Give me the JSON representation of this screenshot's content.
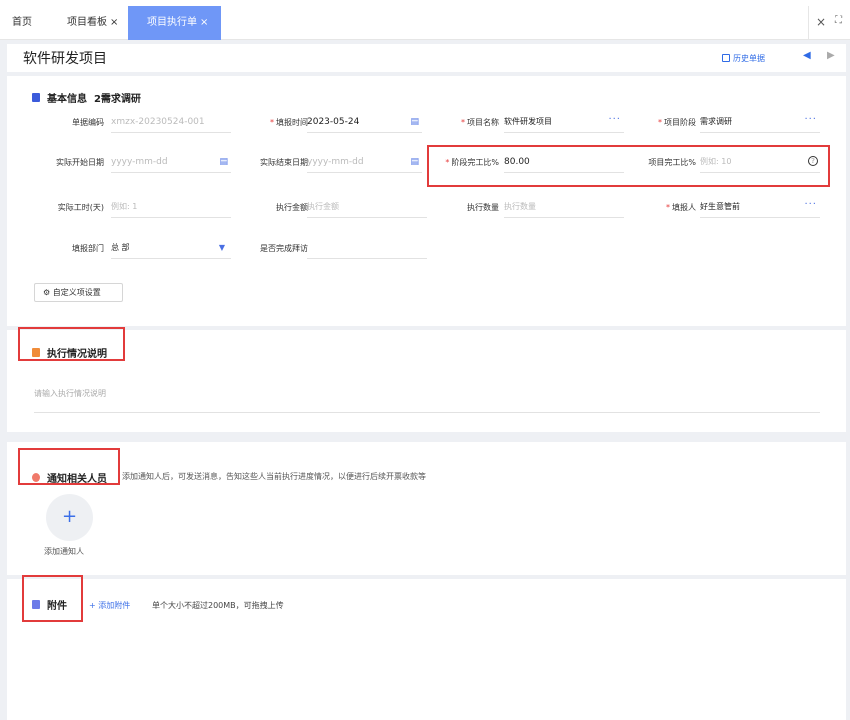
{
  "tabs": {
    "home": "首页",
    "board": "项目看板",
    "active": "项目执行单",
    "close_glyph": "×"
  },
  "header": {
    "title": "软件研发项目",
    "history_label": "历史单据"
  },
  "basic_info": {
    "section_label": "基本信息",
    "stage_title": "2需求调研",
    "custom_button": "自定义项设置",
    "fields": {
      "doc_no": {
        "label": "单据编码",
        "value": "xmzx-20230524-001",
        "required": false
      },
      "report_time": {
        "label": "填报时间",
        "value": "2023-05-24",
        "required": true
      },
      "project_name": {
        "label": "项目名称",
        "value": "软件研发项目",
        "required": true
      },
      "project_stage": {
        "label": "项目阶段",
        "value": "需求调研",
        "required": true
      },
      "actual_start": {
        "label": "实际开始日期",
        "placeholder": "yyyy-mm-dd",
        "required": false
      },
      "actual_end": {
        "label": "实际结束日期",
        "placeholder": "yyyy-mm-dd",
        "required": false
      },
      "stage_percent": {
        "label": "阶段完工比%",
        "value": "80.00",
        "required": true
      },
      "project_percent": {
        "label": "项目完工比%",
        "placeholder": "例如: 10",
        "required": false
      },
      "actual_hours": {
        "label": "实际工时(天)",
        "placeholder": "例如: 1",
        "required": false
      },
      "exec_amount": {
        "label": "执行金额",
        "placeholder": "执行金额",
        "required": false
      },
      "exec_qty": {
        "label": "执行数量",
        "placeholder": "执行数量",
        "required": false
      },
      "reporter": {
        "label": "填报人",
        "value": "好生意管前",
        "required": true
      },
      "department": {
        "label": "填报部门",
        "value": "总 部",
        "required": false
      },
      "visit_done": {
        "label": "是否完成拜访",
        "value": "",
        "required": false
      }
    }
  },
  "execution": {
    "section_label": "执行情况说明",
    "placeholder": "请输入执行情况说明"
  },
  "notify": {
    "section_label": "通知相关人员",
    "description": "添加通知人后，可发送消息，告知这些人当前执行进度情况，以便进行后续开票收款等",
    "add_label": "添加通知人"
  },
  "attachment": {
    "section_label": "附件",
    "add_label": "+ 添加附件",
    "note": "单个大小不超过200MB，可拖拽上传"
  },
  "colors": {
    "accent": "#6f97f7",
    "link": "#2f6be6",
    "required": "#e63a3a",
    "highlight_box": "#e23b3b",
    "basic_icon": "#3b5bdb",
    "exec_icon": "#f08c3a",
    "notify_icon": "#f07a6a",
    "attach_icon": "#6c7be8"
  },
  "icons": [
    "close-icon",
    "fullscreen-icon",
    "history-icon",
    "prev-arrow-icon",
    "next-arrow-icon",
    "calendar-icon",
    "more-dots-icon",
    "chevron-down-icon",
    "help-circle-icon",
    "gear-icon",
    "plus-icon",
    "document-icon",
    "edit-icon",
    "person-icon",
    "folder-icon"
  ]
}
